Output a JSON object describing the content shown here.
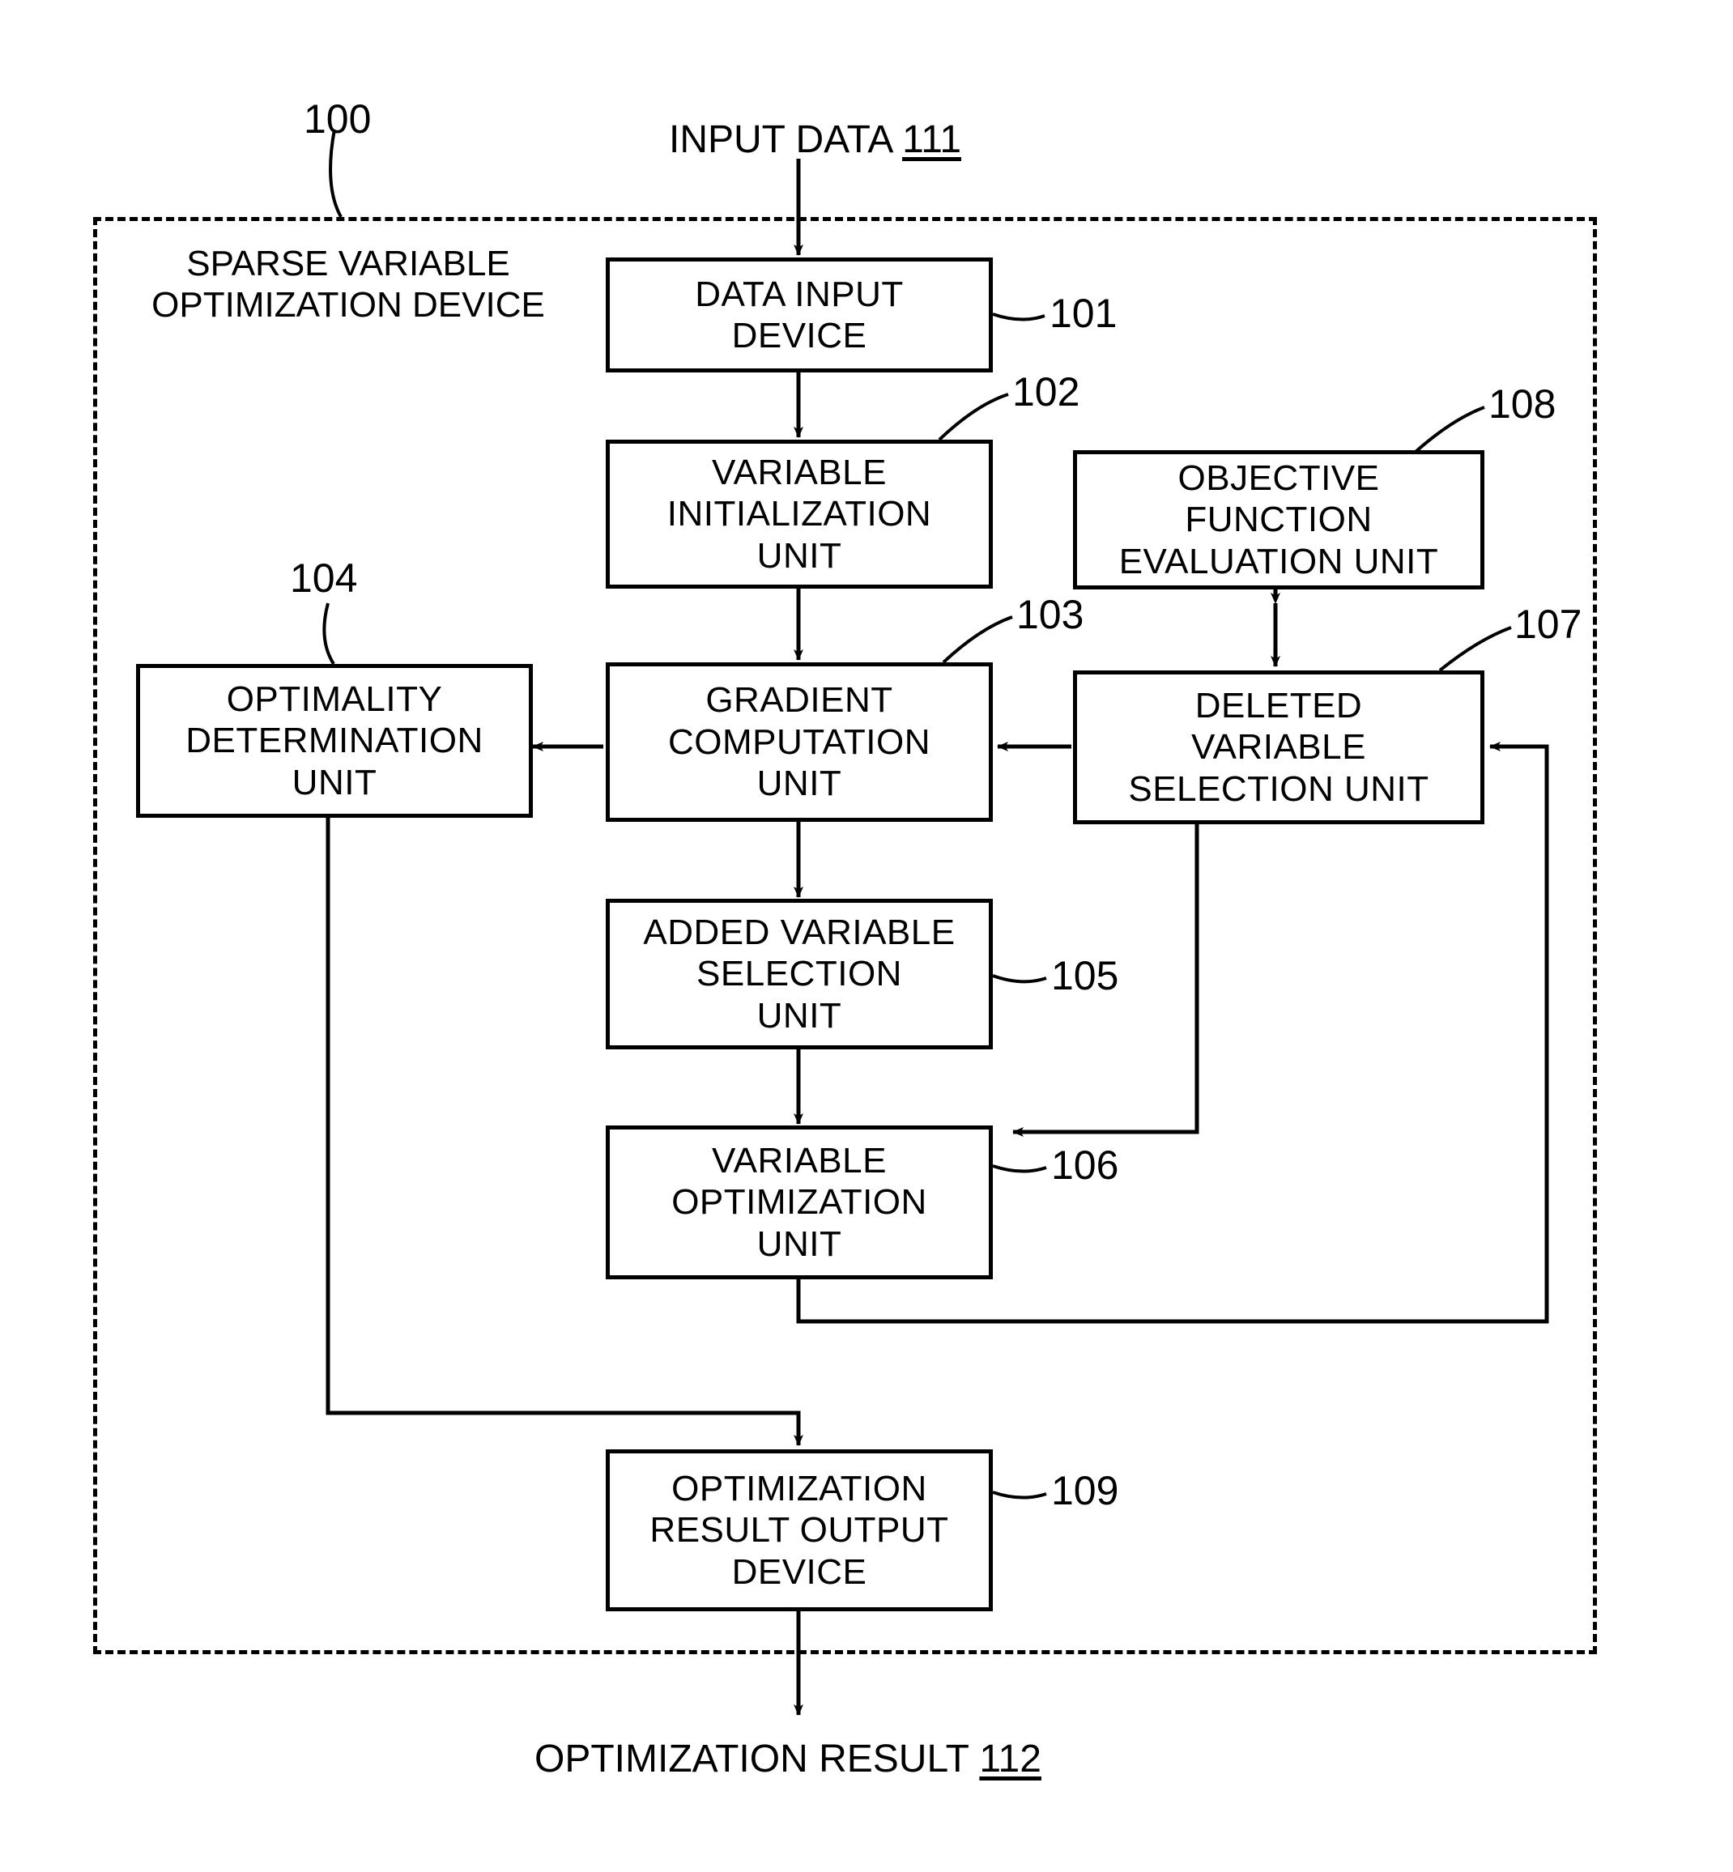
{
  "figure": {
    "device": {
      "ref": "100",
      "title": "SPARSE VARIABLE\nOPTIMIZATION DEVICE"
    },
    "io": {
      "input": {
        "text": "INPUT DATA",
        "ref": "111"
      },
      "output": {
        "text": "OPTIMIZATION RESULT",
        "ref": "112"
      }
    },
    "blocks": [
      {
        "id": "data-input-device",
        "ref": "101",
        "label": "DATA INPUT\nDEVICE"
      },
      {
        "id": "variable-initialization-unit",
        "ref": "102",
        "label": "VARIABLE\nINITIALIZATION\nUNIT"
      },
      {
        "id": "gradient-computation-unit",
        "ref": "103",
        "label": "GRADIENT\nCOMPUTATION\nUNIT"
      },
      {
        "id": "optimality-determination-unit",
        "ref": "104",
        "label": "OPTIMALITY\nDETERMINATION\nUNIT"
      },
      {
        "id": "added-variable-selection-unit",
        "ref": "105",
        "label": "ADDED VARIABLE\nSELECTION\nUNIT"
      },
      {
        "id": "variable-optimization-unit",
        "ref": "106",
        "label": "VARIABLE\nOPTIMIZATION\nUNIT"
      },
      {
        "id": "deleted-variable-selection-unit",
        "ref": "107",
        "label": "DELETED\nVARIABLE\nSELECTION UNIT"
      },
      {
        "id": "objective-function-evaluation-unit",
        "ref": "108",
        "label": "OBJECTIVE\nFUNCTION\nEVALUATION UNIT"
      },
      {
        "id": "optimization-result-output-device",
        "ref": "109",
        "label": "OPTIMIZATION\nRESULT OUTPUT\nDEVICE"
      }
    ],
    "colors": {
      "stroke": "#000000",
      "background": "#ffffff"
    }
  }
}
